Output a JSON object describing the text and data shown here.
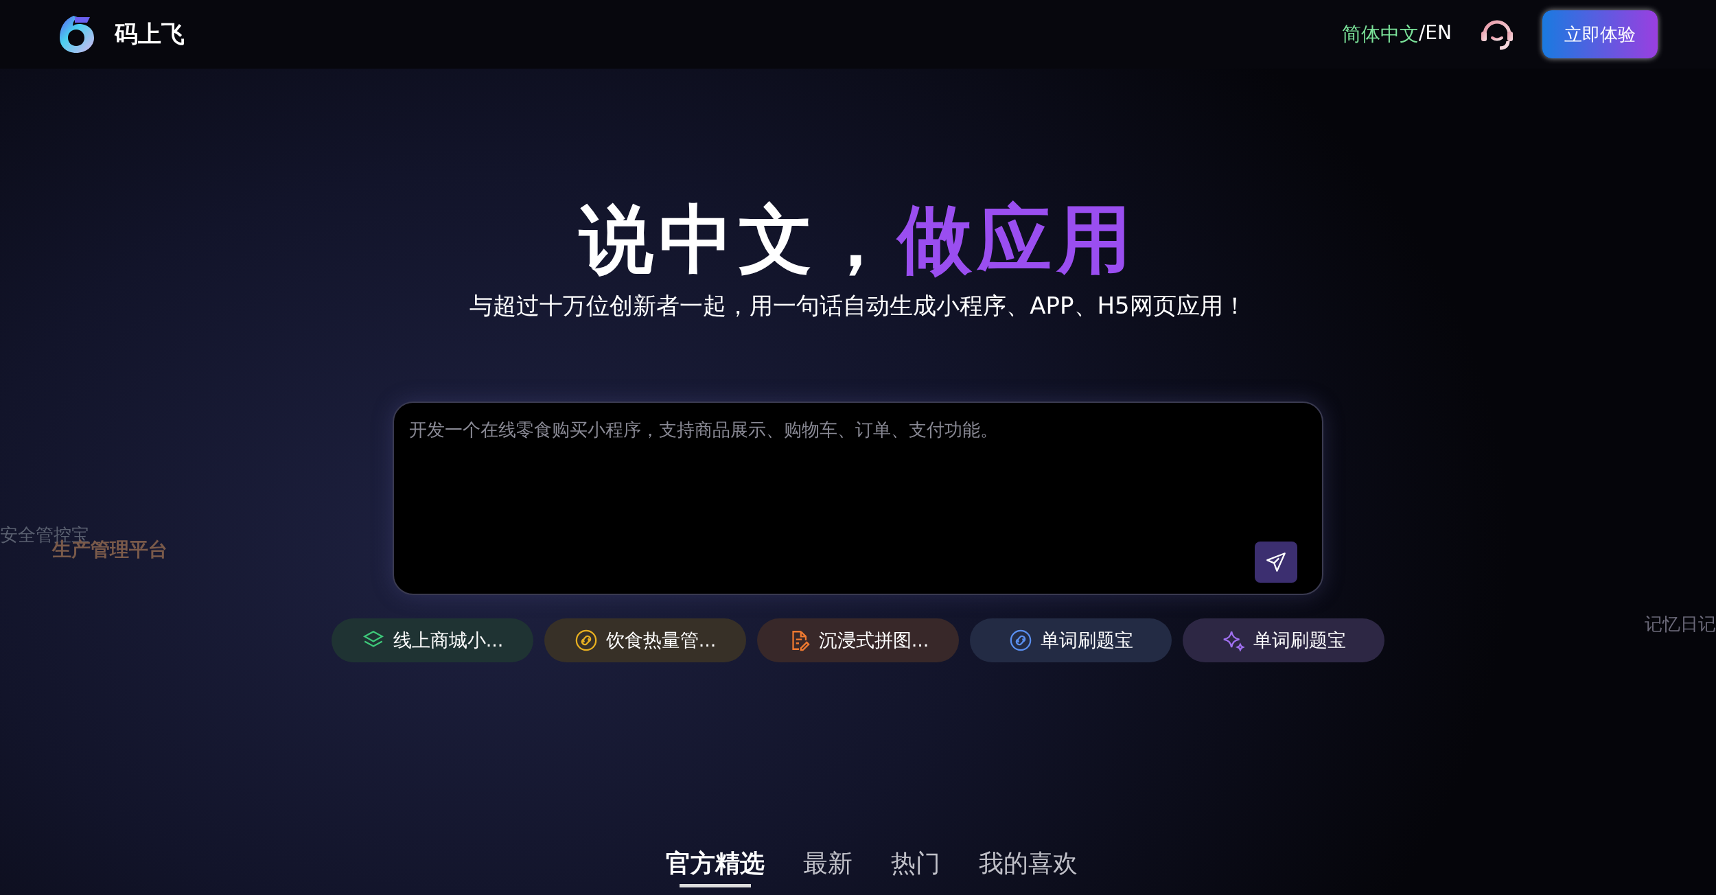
{
  "header": {
    "brand": "码上飞",
    "languages": [
      {
        "label": "简体中文",
        "selected": true
      },
      {
        "label": "/EN",
        "selected": false
      }
    ],
    "cta": "立即体验"
  },
  "hero": {
    "title": "说中文，",
    "title_highlight": "做应用",
    "subtitle": "与超过十万位创新者一起，用一句话自动生成小程序、APP、H5网页应用！"
  },
  "prompt": {
    "placeholder": "开发一个在线零食购买小程序，支持商品展示、购物车、订单、支付功能。"
  },
  "suggestions": [
    {
      "label": "线上商城小...",
      "kind": "layers",
      "color": "#3ec97a"
    },
    {
      "label": "饮食热量管...",
      "kind": "link",
      "color": "#e8b020"
    },
    {
      "label": "沉浸式拼图...",
      "kind": "document",
      "color": "#f07a30"
    },
    {
      "label": "单词刷题宝",
      "kind": "link",
      "color": "#5a8ff0"
    },
    {
      "label": "单词刷题宝",
      "kind": "sparkle",
      "color": "#a070f0"
    }
  ],
  "floating_texts": [
    {
      "text": "安全管控宝",
      "kind": "left-grey"
    },
    {
      "text": "生产管理平台",
      "kind": "left-brown"
    },
    {
      "text": "记忆日记",
      "kind": "right-grey"
    }
  ],
  "tabs": [
    {
      "label": "官方精选",
      "selected": true
    },
    {
      "label": "最新",
      "selected": false
    },
    {
      "label": "热门",
      "selected": false
    },
    {
      "label": "我的喜欢",
      "selected": false
    }
  ]
}
